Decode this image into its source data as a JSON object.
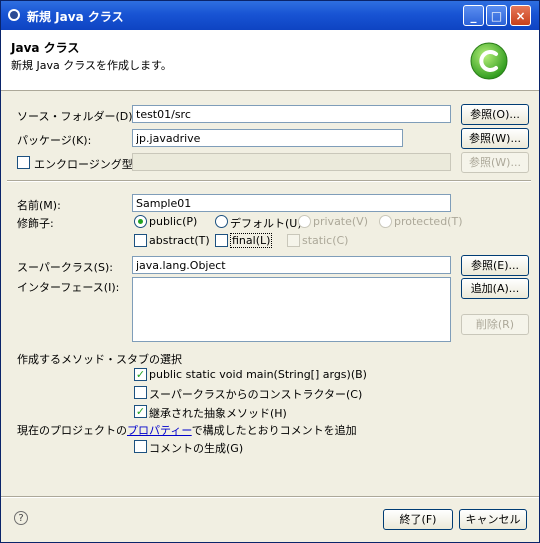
{
  "window": {
    "title": "新規 Java クラス",
    "minimize_label": "_",
    "maximize_label": "□",
    "close_label": "×"
  },
  "header": {
    "title": "Java クラス",
    "description": "新規 Java クラスを作成します。"
  },
  "form": {
    "source_folder": {
      "label": "ソース・フォルダー(D):",
      "value": "test01/src",
      "browse": "参照(O)..."
    },
    "package": {
      "label": "パッケージ(K):",
      "value": "jp.javadrive",
      "browse": "参照(W)..."
    },
    "enclosing_type": {
      "label": "エンクロージング型(Y):",
      "value": "",
      "browse": "参照(W)..."
    },
    "name": {
      "label": "名前(M):",
      "value": "Sample01"
    },
    "modifiers": {
      "label": "修飾子:",
      "public": "public(P)",
      "default": "デフォルト(U)",
      "private": "private(V)",
      "protected": "protected(T)",
      "abstract": "abstract(T)",
      "final": "final(L)",
      "static": "static(C)"
    },
    "superclass": {
      "label": "スーパークラス(S):",
      "value": "java.lang.Object",
      "browse": "参照(E)..."
    },
    "interfaces": {
      "label": "インターフェース(I):",
      "add": "追加(A)...",
      "remove": "削除(R)"
    },
    "stubs": {
      "label": "作成するメソッド・スタブの選択",
      "main": "public static void main(String[] args)(B)",
      "constructors": "スーパークラスからのコンストラクター(C)",
      "inherited": "継承された抽象メソッド(H)"
    },
    "comments": {
      "prefix": "現在のプロジェクトの",
      "link": "プロパティー",
      "suffix": "で構成したとおりコメントを追加",
      "generate": "コメントの生成(G)"
    }
  },
  "footer": {
    "help": "?",
    "finish": "終了(F)",
    "cancel": "キャンセル"
  },
  "checks": {
    "mark": "✓"
  }
}
